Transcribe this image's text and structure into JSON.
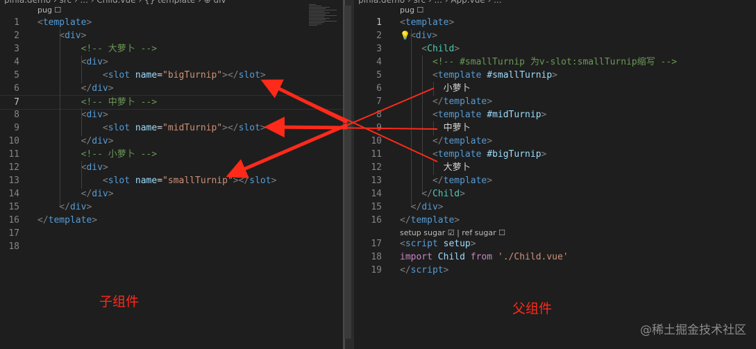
{
  "left_editor": {
    "breadcrumb": "pinia.demo › src › ... › Child.vue › {} template › ⊕ div",
    "lens": "pug ☐",
    "lines": [
      {
        "n": "1",
        "tokens": [
          [
            "<",
            "tag-p"
          ],
          [
            "template",
            "tag-n"
          ],
          [
            ">",
            "tag-p"
          ]
        ]
      },
      {
        "n": "2",
        "tokens": [
          [
            "    <",
            "tag-p"
          ],
          [
            "div",
            "tag-n"
          ],
          [
            ">",
            "tag-p"
          ]
        ]
      },
      {
        "n": "3",
        "tokens": [
          [
            "        <!-- 大萝卜 -->",
            "cmt"
          ]
        ]
      },
      {
        "n": "4",
        "tokens": [
          [
            "        <",
            "tag-p"
          ],
          [
            "div",
            "tag-n"
          ],
          [
            ">",
            "tag-p"
          ]
        ]
      },
      {
        "n": "5",
        "tokens": [
          [
            "            <",
            "tag-p"
          ],
          [
            "slot",
            "tag-n"
          ],
          [
            " ",
            "plain"
          ],
          [
            "name",
            "attr-n"
          ],
          [
            "=",
            "plain"
          ],
          [
            "\"bigTurnip\"",
            "str"
          ],
          [
            "></",
            "tag-p"
          ],
          [
            "slot",
            "tag-n"
          ],
          [
            ">",
            "tag-p"
          ]
        ]
      },
      {
        "n": "6",
        "tokens": [
          [
            "        </",
            "tag-p"
          ],
          [
            "div",
            "tag-n"
          ],
          [
            ">",
            "tag-p"
          ]
        ]
      },
      {
        "n": "7",
        "tokens": [
          [
            "        <!-- 中萝卜 -->",
            "cmt"
          ]
        ]
      },
      {
        "n": "8",
        "tokens": [
          [
            "        <",
            "tag-p"
          ],
          [
            "div",
            "tag-n"
          ],
          [
            ">",
            "tag-p"
          ]
        ]
      },
      {
        "n": "9",
        "tokens": [
          [
            "            <",
            "tag-p"
          ],
          [
            "slot",
            "tag-n"
          ],
          [
            " ",
            "plain"
          ],
          [
            "name",
            "attr-n"
          ],
          [
            "=",
            "plain"
          ],
          [
            "\"midTurnip\"",
            "str"
          ],
          [
            "></",
            "tag-p"
          ],
          [
            "slot",
            "tag-n"
          ],
          [
            ">",
            "tag-p"
          ]
        ]
      },
      {
        "n": "10",
        "tokens": [
          [
            "        </",
            "tag-p"
          ],
          [
            "div",
            "tag-n"
          ],
          [
            ">",
            "tag-p"
          ]
        ]
      },
      {
        "n": "11",
        "tokens": [
          [
            "        <!-- 小萝卜 -->",
            "cmt"
          ]
        ]
      },
      {
        "n": "12",
        "tokens": [
          [
            "        <",
            "tag-p"
          ],
          [
            "div",
            "tag-n"
          ],
          [
            ">",
            "tag-p"
          ]
        ]
      },
      {
        "n": "13",
        "tokens": [
          [
            "            <",
            "tag-p"
          ],
          [
            "slot",
            "tag-n"
          ],
          [
            " ",
            "plain"
          ],
          [
            "name",
            "attr-n"
          ],
          [
            "=",
            "plain"
          ],
          [
            "\"smallTurnip\"",
            "str"
          ],
          [
            "></",
            "tag-p"
          ],
          [
            "slot",
            "tag-n"
          ],
          [
            ">",
            "tag-p"
          ]
        ]
      },
      {
        "n": "14",
        "tokens": [
          [
            "        </",
            "tag-p"
          ],
          [
            "div",
            "tag-n"
          ],
          [
            ">",
            "tag-p"
          ]
        ]
      },
      {
        "n": "15",
        "tokens": [
          [
            "    </",
            "tag-p"
          ],
          [
            "div",
            "tag-n"
          ],
          [
            ">",
            "tag-p"
          ]
        ]
      },
      {
        "n": "16",
        "tokens": [
          [
            "</",
            "tag-p"
          ],
          [
            "template",
            "tag-n"
          ],
          [
            ">",
            "tag-p"
          ]
        ]
      },
      {
        "n": "17",
        "tokens": []
      },
      {
        "n": "18",
        "tokens": []
      }
    ],
    "active_line": "7"
  },
  "right_editor": {
    "breadcrumb": "pinia.demo › src › ... › App.vue › ...",
    "lens": "pug ☐",
    "lens2": "setup sugar ☑ | ref sugar ☐",
    "lines": [
      {
        "n": "1",
        "tokens": [
          [
            "<",
            "tag-p"
          ],
          [
            "template",
            "tag-n"
          ],
          [
            ">",
            "tag-p"
          ]
        ]
      },
      {
        "n": "2",
        "tokens": [
          [
            "💡",
            "bulb"
          ],
          [
            "<",
            "tag-p"
          ],
          [
            "div",
            "tag-n"
          ],
          [
            ">",
            "tag-p"
          ]
        ]
      },
      {
        "n": "3",
        "tokens": [
          [
            "    <",
            "tag-p"
          ],
          [
            "Child",
            "comp-n"
          ],
          [
            ">",
            "tag-p"
          ]
        ]
      },
      {
        "n": "4",
        "tokens": [
          [
            "      <!-- #smallTurnip 为v-slot:smallTurnip缩写 -->",
            "cmt"
          ]
        ]
      },
      {
        "n": "5",
        "tokens": [
          [
            "      <",
            "tag-p"
          ],
          [
            "template",
            "tag-n"
          ],
          [
            " ",
            "plain"
          ],
          [
            "#smallTurnip",
            "attr-n"
          ],
          [
            ">",
            "tag-p"
          ]
        ]
      },
      {
        "n": "6",
        "tokens": [
          [
            "        小萝卜",
            "plain"
          ]
        ]
      },
      {
        "n": "7",
        "tokens": [
          [
            "      </",
            "tag-p"
          ],
          [
            "template",
            "tag-n"
          ],
          [
            ">",
            "tag-p"
          ]
        ]
      },
      {
        "n": "8",
        "tokens": [
          [
            "      <",
            "tag-p"
          ],
          [
            "template",
            "tag-n"
          ],
          [
            " ",
            "plain"
          ],
          [
            "#midTurnip",
            "attr-n"
          ],
          [
            ">",
            "tag-p"
          ]
        ]
      },
      {
        "n": "9",
        "tokens": [
          [
            "        中萝卜",
            "plain"
          ]
        ]
      },
      {
        "n": "10",
        "tokens": [
          [
            "      </",
            "tag-p"
          ],
          [
            "template",
            "tag-n"
          ],
          [
            ">",
            "tag-p"
          ]
        ]
      },
      {
        "n": "11",
        "tokens": [
          [
            "      <",
            "tag-p"
          ],
          [
            "template",
            "tag-n"
          ],
          [
            " ",
            "plain"
          ],
          [
            "#bigTurnip",
            "attr-n"
          ],
          [
            ">",
            "tag-p"
          ]
        ]
      },
      {
        "n": "12",
        "tokens": [
          [
            "        大萝卜",
            "plain"
          ]
        ]
      },
      {
        "n": "13",
        "tokens": [
          [
            "      </",
            "tag-p"
          ],
          [
            "template",
            "tag-n"
          ],
          [
            ">",
            "tag-p"
          ]
        ]
      },
      {
        "n": "14",
        "tokens": [
          [
            "    </",
            "tag-p"
          ],
          [
            "Child",
            "comp-n"
          ],
          [
            ">",
            "tag-p"
          ]
        ]
      },
      {
        "n": "15",
        "tokens": [
          [
            "  </",
            "tag-p"
          ],
          [
            "div",
            "tag-n"
          ],
          [
            ">",
            "tag-p"
          ]
        ]
      },
      {
        "n": "16",
        "tokens": [
          [
            "</",
            "tag-p"
          ],
          [
            "template",
            "tag-n"
          ],
          [
            ">",
            "tag-p"
          ]
        ]
      }
    ],
    "script_lines": [
      {
        "n": "17",
        "tokens": [
          [
            "<",
            "tag-p"
          ],
          [
            "script",
            "tag-n"
          ],
          [
            " ",
            "plain"
          ],
          [
            "setup",
            "attr-n"
          ],
          [
            ">",
            "tag-p"
          ]
        ]
      },
      {
        "n": "18",
        "tokens": [
          [
            "import",
            "kw"
          ],
          [
            " ",
            "plain"
          ],
          [
            "Child",
            "attr-n"
          ],
          [
            " ",
            "plain"
          ],
          [
            "from",
            "kw"
          ],
          [
            " ",
            "plain"
          ],
          [
            "'./Child.vue'",
            "str"
          ]
        ]
      },
      {
        "n": "19",
        "tokens": [
          [
            "</",
            "tag-p"
          ],
          [
            "script",
            "tag-n"
          ],
          [
            ">",
            "tag-p"
          ]
        ]
      }
    ],
    "active_line": "1"
  },
  "annotations": {
    "child_label": "子组件",
    "parent_label": "父组件",
    "arrow_color": "#ff2a1a"
  },
  "watermark": "@稀土掘金技术社区"
}
